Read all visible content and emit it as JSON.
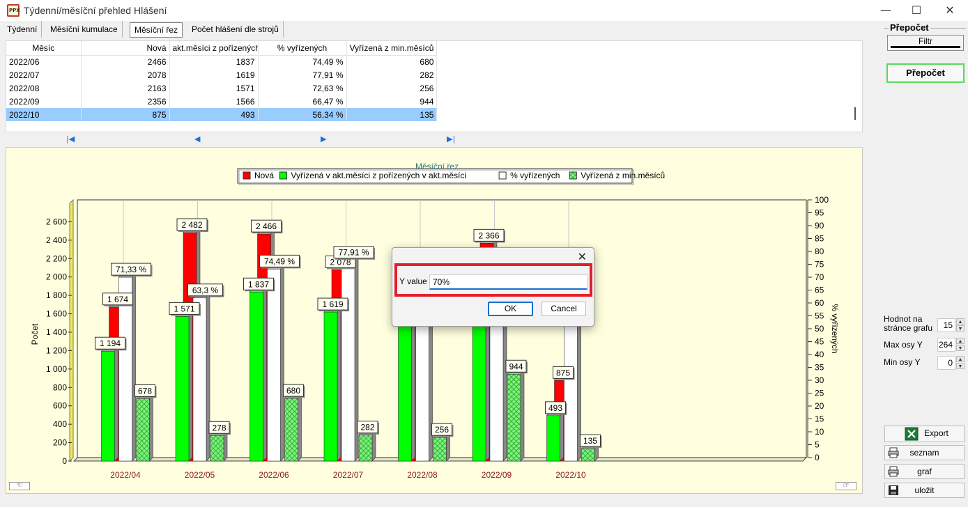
{
  "window": {
    "title": "Týdenní/měsíční přehled Hlášení",
    "app_icon_text": "PPX",
    "minimize_glyph": "—",
    "maximize_glyph": "☐",
    "close_glyph": "✕"
  },
  "tabs": [
    {
      "label": "Týdenní",
      "active": false
    },
    {
      "label": "Měsíční kumulace",
      "active": false
    },
    {
      "label": "Měsíční řez",
      "active": true
    },
    {
      "label": "Počet hlášení dle strojů",
      "active": false
    }
  ],
  "table": {
    "columns": [
      "Měsíc",
      "Nová",
      "akt.měsíci z pořízených v",
      "% vyřízených",
      "Vyřízená z min.měsíců"
    ],
    "rows": [
      [
        "2022/06",
        "2466",
        "1837",
        "74,49 %",
        "680"
      ],
      [
        "2022/07",
        "2078",
        "1619",
        "77,91 %",
        "282"
      ],
      [
        "2022/08",
        "2163",
        "1571",
        "72,63 %",
        "256"
      ],
      [
        "2022/09",
        "2356",
        "1566",
        "66,47 %",
        "944"
      ],
      [
        "2022/10",
        "875",
        "493",
        "56,34 %",
        "135"
      ]
    ],
    "selected_row": 4
  },
  "nav": {
    "first_glyph": "|◀",
    "prev_glyph": "◀",
    "next_glyph": "▶",
    "last_glyph": "▶|"
  },
  "right_panel": {
    "group_title": "Přepočet",
    "filter_label": "Filtr",
    "recalc_label": "Přepočet",
    "values_per_page_label": "Hodnot na stránce grafu",
    "values_per_page": "15",
    "max_y_label": "Max osy Y",
    "max_y": "264",
    "min_y_label": "Min osy Y",
    "min_y": "0",
    "export_label": "Export",
    "list_label": "seznam",
    "chart_label": "graf",
    "save_label": "uložit",
    "spin_up_glyph": "▲",
    "spin_down_glyph": "▼"
  },
  "dialog": {
    "close_glyph": "✕",
    "field_label": "Y value",
    "field_value": "70%",
    "ok_label": "OK",
    "cancel_label": "Cancel"
  },
  "chart_data": {
    "type": "bar",
    "title": "Měsíční řez",
    "categories": [
      "2022/04",
      "2022/05",
      "2022/06",
      "2022/07",
      "2022/08",
      "2022/09",
      "2022/10"
    ],
    "ylabel": "Počet",
    "y2label": "% vyřízených",
    "ylim": [
      0,
      2800
    ],
    "y_ticks": [
      "0",
      "200",
      "400",
      "600",
      "800",
      "1 000",
      "1 200",
      "1 400",
      "1 600",
      "1 800",
      "2 000",
      "2 200",
      "2 400",
      "2 600"
    ],
    "y2lim": [
      0,
      100
    ],
    "y2_ticks": [
      "0",
      "5",
      "10",
      "15",
      "20",
      "25",
      "30",
      "35",
      "40",
      "45",
      "50",
      "55",
      "60",
      "65",
      "70",
      "75",
      "80",
      "85",
      "90",
      "95",
      "100"
    ],
    "legend_position": "top",
    "grid": true,
    "series": [
      {
        "name": "Nová",
        "axis": "left",
        "color": "#ff0000",
        "values": [
          1674,
          2482,
          2466,
          2078,
          2163,
          2366,
          875
        ],
        "labels": [
          "1 674",
          "2 482",
          "2 466",
          "2 078",
          "",
          "2 366",
          "875"
        ]
      },
      {
        "name": "Vyřízená v akt.měsíci z pořízených v akt.měsíci",
        "axis": "left",
        "color": "#00ff00",
        "values": [
          1194,
          1571,
          1837,
          1619,
          1571,
          1566,
          493
        ],
        "labels": [
          "1 194",
          "1 571",
          "1 837",
          "1 619",
          "",
          "",
          "493"
        ]
      },
      {
        "name": "% vyřízených",
        "axis": "right",
        "color": "#ffffff",
        "values": [
          71.33,
          63.3,
          74.49,
          77.91,
          72.63,
          66.47,
          56.34
        ],
        "labels": [
          "71,33 %",
          "63,3 %",
          "74,49 %",
          "77,91 %",
          "",
          "",
          ""
        ]
      },
      {
        "name": "Vyřízená z min.měsíců",
        "axis": "left",
        "color": "#66ee66",
        "pattern": "hatched",
        "values": [
          678,
          278,
          680,
          282,
          256,
          944,
          135
        ],
        "labels": [
          "678",
          "278",
          "680",
          "282",
          "256",
          "944",
          "135"
        ]
      }
    ]
  }
}
